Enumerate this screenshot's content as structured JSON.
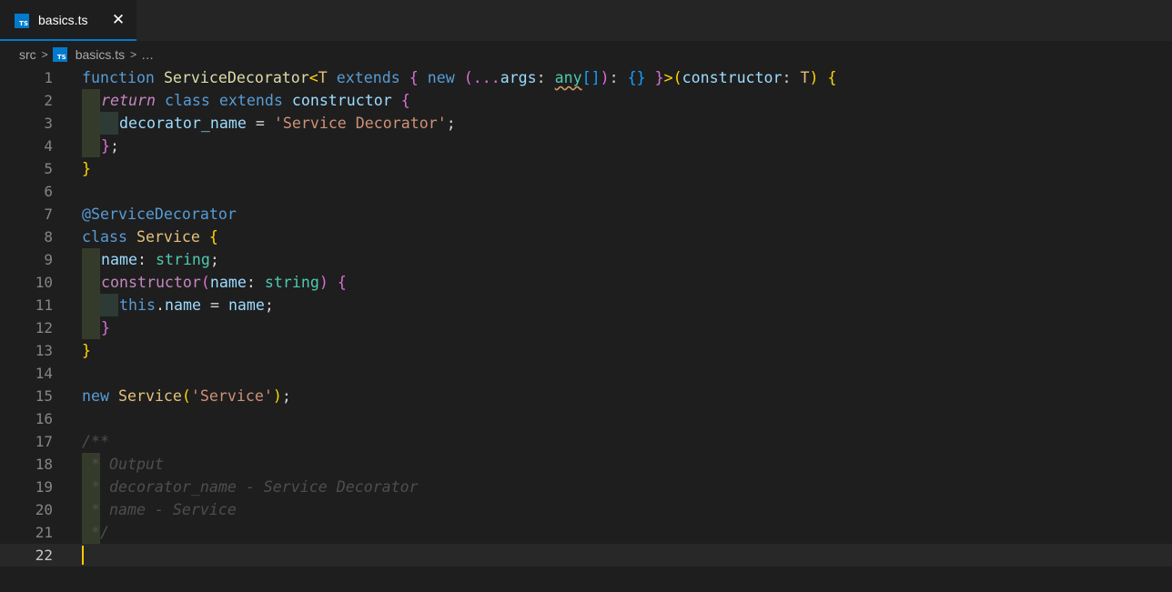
{
  "tab": {
    "icon": "typescript-file-icon",
    "icon_text": "TS",
    "label": "basics.ts",
    "close_glyph": "✕"
  },
  "breadcrumb": {
    "folder": "src",
    "file": "basics.ts",
    "rest": "…"
  },
  "gutter": [
    "1",
    "2",
    "3",
    "4",
    "5",
    "6",
    "7",
    "8",
    "9",
    "10",
    "11",
    "12",
    "13",
    "14",
    "15",
    "16",
    "17",
    "18",
    "19",
    "20",
    "21",
    "22"
  ],
  "code": {
    "l1": {
      "kw_function": "function",
      "fn_name": "ServiceDecorator",
      "lt": "<",
      "T1": "T",
      "extends1": "extends",
      "brace_open": "{",
      "new": "new",
      "paren_open": "(",
      "spread": "...",
      "args": "args",
      "colon1": ":",
      "any": "any",
      "brackets": "[]",
      "paren_close": ")",
      "colon2": ":",
      "empty_obj": "{}",
      "brace_close": "}",
      "gt": ">",
      "paren2_open": "(",
      "param": "constructor",
      "colon3": ":",
      "T2": "T",
      "paren2_close": ")",
      "body_open": "{"
    },
    "l2": {
      "return": "return",
      "class": "class",
      "extends": "extends",
      "ctor": "constructor",
      "brace": "{"
    },
    "l3": {
      "prop": "decorator_name",
      "eq": "=",
      "str": "'Service Decorator'",
      "semi": ";"
    },
    "l4": {
      "brace": "}",
      "semi": ";"
    },
    "l5": {
      "brace": "}"
    },
    "l7": {
      "decorator": "@ServiceDecorator"
    },
    "l8": {
      "class": "class",
      "name": "Service",
      "brace": "{"
    },
    "l9": {
      "prop": "name",
      "colon": ":",
      "type": "string",
      "semi": ";"
    },
    "l10": {
      "ctor": "constructor",
      "paren_open": "(",
      "param": "name",
      "colon": ":",
      "type": "string",
      "paren_close": ")",
      "brace": "{"
    },
    "l11": {
      "this": "this",
      "dot": ".",
      "prop": "name",
      "eq": "=",
      "value": "name",
      "semi": ";"
    },
    "l12": {
      "brace": "}"
    },
    "l13": {
      "brace": "}"
    },
    "l15": {
      "new": "new",
      "name": "Service",
      "paren_open": "(",
      "str": "'Service'",
      "paren_close": ")",
      "semi": ";"
    },
    "l17": {
      "text": "/**"
    },
    "l18": {
      "text": " * Output"
    },
    "l19": {
      "text": " * decorator_name - Service Decorator"
    },
    "l20": {
      "text": " * name - Service"
    },
    "l21": {
      "text": " */"
    }
  },
  "colors": {
    "accent": "#007acc",
    "background": "#1e1e1e",
    "tabbar": "#252526",
    "cursor": "#ffcc00"
  }
}
